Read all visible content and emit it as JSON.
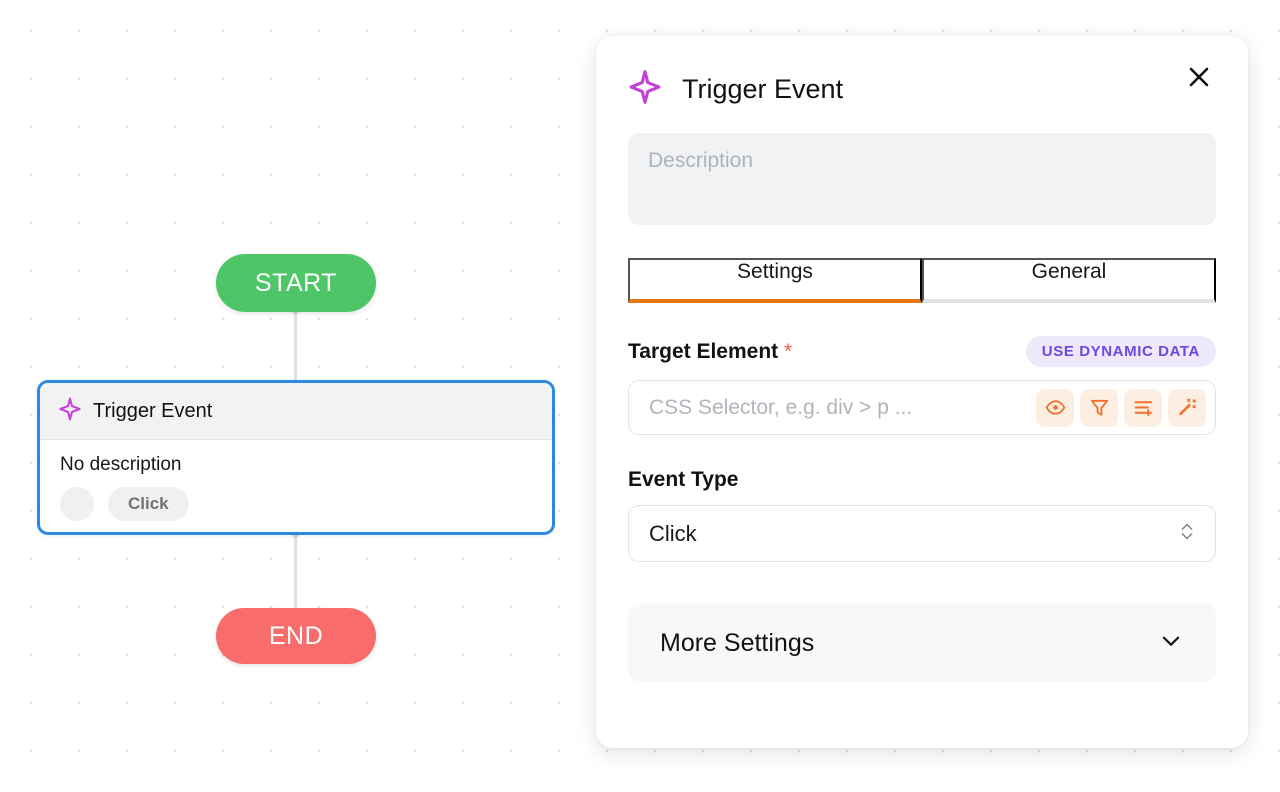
{
  "canvas": {
    "nodes": {
      "start": {
        "label": "START",
        "color": "#4ec566"
      },
      "end": {
        "label": "END",
        "color": "#f96c6c"
      },
      "trigger": {
        "title": "Trigger Event",
        "icon": "sparkle-icon",
        "description": "No description",
        "badge": "Click"
      }
    }
  },
  "panel": {
    "icon": "sparkle-icon",
    "title": "Trigger Event",
    "close_icon": "close-icon",
    "description": {
      "value": "",
      "placeholder": "Description"
    },
    "tabs": [
      {
        "label": "Settings",
        "active": true
      },
      {
        "label": "General",
        "active": false
      }
    ],
    "target_element": {
      "label": "Target Element",
      "required_marker": "*",
      "dynamic_data_label": "USE DYNAMIC DATA",
      "input": {
        "value": "",
        "placeholder": "CSS Selector, e.g. div > p ..."
      },
      "icon_buttons": [
        {
          "name": "eye-icon"
        },
        {
          "name": "filter-icon"
        },
        {
          "name": "list-add-icon"
        },
        {
          "name": "magic-wand-icon"
        }
      ]
    },
    "event_type": {
      "label": "Event Type",
      "value": "Click",
      "options": [
        "Click"
      ]
    },
    "more_settings": {
      "label": "More Settings",
      "chevron_icon": "chevron-down-icon"
    }
  },
  "colors": {
    "accent_orange": "#e8770f",
    "icon_orange": "#f2702a",
    "icon_bg": "#fdeee2",
    "purple": "#6b48e0",
    "purple_badge_bg": "#ede9fb",
    "sparkle": "#c243d6",
    "selection_blue": "#2b8ae0",
    "required_red": "#f4584f"
  }
}
